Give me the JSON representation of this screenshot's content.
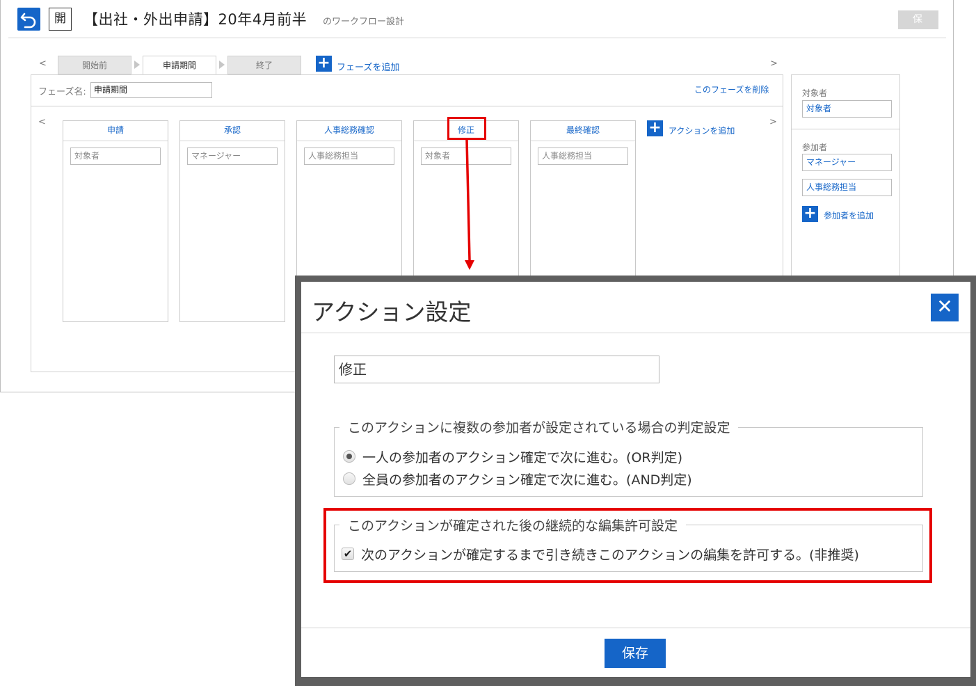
{
  "header": {
    "open_label": "開",
    "title": "【出社・外出申請】20年4月前半",
    "title_suffix": "のワークフロー設計",
    "save_label": "保 存"
  },
  "phase_nav": {
    "prev": "<",
    "next": ">",
    "tabs": [
      {
        "label": "開始前"
      },
      {
        "label": "申請期間"
      },
      {
        "label": "終了"
      }
    ],
    "add_phase_label": "フェーズを追加"
  },
  "phase": {
    "name_label": "フェーズ名:",
    "name_value": "申請期間",
    "delete_label": "このフェーズを削除",
    "prev": "<",
    "next": ">",
    "add_action_label": "アクションを追加",
    "actions": [
      {
        "name": "申請",
        "assignee": "対象者"
      },
      {
        "name": "承認",
        "assignee": "マネージャー"
      },
      {
        "name": "人事総務確認",
        "assignee": "人事総務担当"
      },
      {
        "name": "修正",
        "assignee": "対象者"
      },
      {
        "name": "最終確認",
        "assignee": "人事総務担当"
      }
    ]
  },
  "side": {
    "target_label": "対象者",
    "target_value": "対象者",
    "participants_label": "参加者",
    "participants": [
      "マネージャー",
      "人事総務担当"
    ],
    "add_participant_label": "参加者を追加"
  },
  "modal": {
    "title": "アクション設定",
    "close": "✕",
    "action_name": "修正",
    "judgement_legend": "このアクションに複数の参加者が設定されている場合の判定設定",
    "options": [
      {
        "label": "一人の参加者のアクション確定で次に進む。(OR判定)",
        "selected": true
      },
      {
        "label": "全員の参加者のアクション確定で次に進む。(AND判定)",
        "selected": false
      }
    ],
    "edit_legend": "このアクションが確定された後の継続的な編集許可設定",
    "edit_checkbox_label": "次のアクションが確定するまで引き続きこのアクションの編集を許可する。(非推奨)",
    "edit_checkbox_checked": true,
    "save_label": "保存"
  },
  "colors": {
    "accent": "#1565c8",
    "annotation": "#e50000"
  }
}
